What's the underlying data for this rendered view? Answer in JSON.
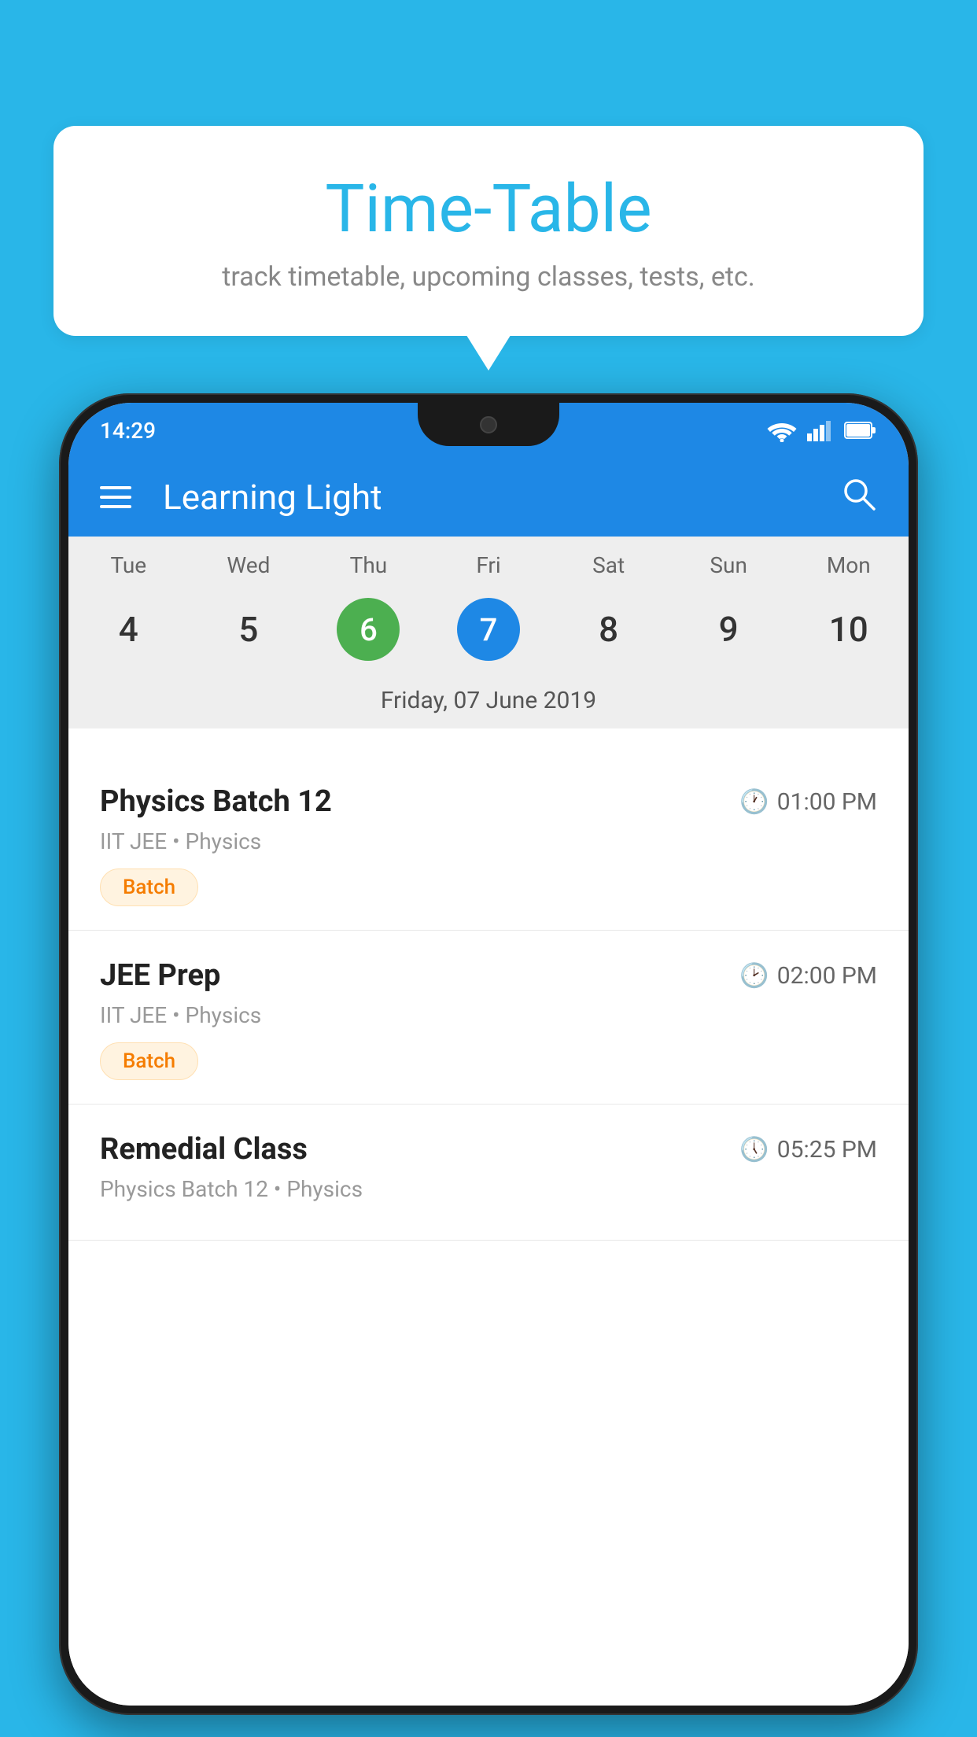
{
  "background_color": "#29B6E8",
  "speech_bubble": {
    "title": "Time-Table",
    "subtitle": "track timetable, upcoming classes, tests, etc."
  },
  "phone": {
    "status_bar": {
      "time": "14:29"
    },
    "header": {
      "title": "Learning Light"
    },
    "calendar": {
      "days": [
        "Tue",
        "Wed",
        "Thu",
        "Fri",
        "Sat",
        "Sun",
        "Mon"
      ],
      "dates": [
        "4",
        "5",
        "6",
        "7",
        "8",
        "9",
        "10"
      ],
      "today_index": 2,
      "selected_index": 3,
      "selected_date_label": "Friday, 07 June 2019"
    },
    "schedule_items": [
      {
        "title": "Physics Batch 12",
        "time": "01:00 PM",
        "sub": "IIT JEE • Physics",
        "badge": "Batch"
      },
      {
        "title": "JEE Prep",
        "time": "02:00 PM",
        "sub": "IIT JEE • Physics",
        "badge": "Batch"
      },
      {
        "title": "Remedial Class",
        "time": "05:25 PM",
        "sub": "Physics Batch 12 • Physics",
        "badge": ""
      }
    ]
  }
}
